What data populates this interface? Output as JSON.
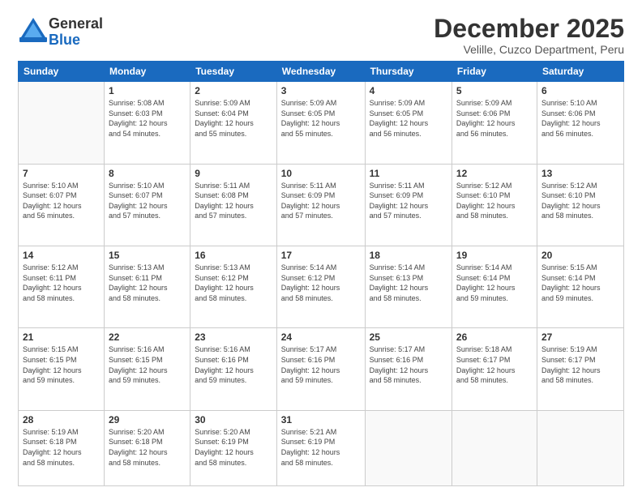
{
  "logo": {
    "general": "General",
    "blue": "Blue"
  },
  "title": "December 2025",
  "subtitle": "Velille, Cuzco Department, Peru",
  "days_header": [
    "Sunday",
    "Monday",
    "Tuesday",
    "Wednesday",
    "Thursday",
    "Friday",
    "Saturday"
  ],
  "weeks": [
    [
      {
        "num": "",
        "info": ""
      },
      {
        "num": "1",
        "info": "Sunrise: 5:08 AM\nSunset: 6:03 PM\nDaylight: 12 hours\nand 54 minutes."
      },
      {
        "num": "2",
        "info": "Sunrise: 5:09 AM\nSunset: 6:04 PM\nDaylight: 12 hours\nand 55 minutes."
      },
      {
        "num": "3",
        "info": "Sunrise: 5:09 AM\nSunset: 6:05 PM\nDaylight: 12 hours\nand 55 minutes."
      },
      {
        "num": "4",
        "info": "Sunrise: 5:09 AM\nSunset: 6:05 PM\nDaylight: 12 hours\nand 56 minutes."
      },
      {
        "num": "5",
        "info": "Sunrise: 5:09 AM\nSunset: 6:06 PM\nDaylight: 12 hours\nand 56 minutes."
      },
      {
        "num": "6",
        "info": "Sunrise: 5:10 AM\nSunset: 6:06 PM\nDaylight: 12 hours\nand 56 minutes."
      }
    ],
    [
      {
        "num": "7",
        "info": "Sunrise: 5:10 AM\nSunset: 6:07 PM\nDaylight: 12 hours\nand 56 minutes."
      },
      {
        "num": "8",
        "info": "Sunrise: 5:10 AM\nSunset: 6:07 PM\nDaylight: 12 hours\nand 57 minutes."
      },
      {
        "num": "9",
        "info": "Sunrise: 5:11 AM\nSunset: 6:08 PM\nDaylight: 12 hours\nand 57 minutes."
      },
      {
        "num": "10",
        "info": "Sunrise: 5:11 AM\nSunset: 6:09 PM\nDaylight: 12 hours\nand 57 minutes."
      },
      {
        "num": "11",
        "info": "Sunrise: 5:11 AM\nSunset: 6:09 PM\nDaylight: 12 hours\nand 57 minutes."
      },
      {
        "num": "12",
        "info": "Sunrise: 5:12 AM\nSunset: 6:10 PM\nDaylight: 12 hours\nand 58 minutes."
      },
      {
        "num": "13",
        "info": "Sunrise: 5:12 AM\nSunset: 6:10 PM\nDaylight: 12 hours\nand 58 minutes."
      }
    ],
    [
      {
        "num": "14",
        "info": "Sunrise: 5:12 AM\nSunset: 6:11 PM\nDaylight: 12 hours\nand 58 minutes."
      },
      {
        "num": "15",
        "info": "Sunrise: 5:13 AM\nSunset: 6:11 PM\nDaylight: 12 hours\nand 58 minutes."
      },
      {
        "num": "16",
        "info": "Sunrise: 5:13 AM\nSunset: 6:12 PM\nDaylight: 12 hours\nand 58 minutes."
      },
      {
        "num": "17",
        "info": "Sunrise: 5:14 AM\nSunset: 6:12 PM\nDaylight: 12 hours\nand 58 minutes."
      },
      {
        "num": "18",
        "info": "Sunrise: 5:14 AM\nSunset: 6:13 PM\nDaylight: 12 hours\nand 58 minutes."
      },
      {
        "num": "19",
        "info": "Sunrise: 5:14 AM\nSunset: 6:14 PM\nDaylight: 12 hours\nand 59 minutes."
      },
      {
        "num": "20",
        "info": "Sunrise: 5:15 AM\nSunset: 6:14 PM\nDaylight: 12 hours\nand 59 minutes."
      }
    ],
    [
      {
        "num": "21",
        "info": "Sunrise: 5:15 AM\nSunset: 6:15 PM\nDaylight: 12 hours\nand 59 minutes."
      },
      {
        "num": "22",
        "info": "Sunrise: 5:16 AM\nSunset: 6:15 PM\nDaylight: 12 hours\nand 59 minutes."
      },
      {
        "num": "23",
        "info": "Sunrise: 5:16 AM\nSunset: 6:16 PM\nDaylight: 12 hours\nand 59 minutes."
      },
      {
        "num": "24",
        "info": "Sunrise: 5:17 AM\nSunset: 6:16 PM\nDaylight: 12 hours\nand 59 minutes."
      },
      {
        "num": "25",
        "info": "Sunrise: 5:17 AM\nSunset: 6:16 PM\nDaylight: 12 hours\nand 58 minutes."
      },
      {
        "num": "26",
        "info": "Sunrise: 5:18 AM\nSunset: 6:17 PM\nDaylight: 12 hours\nand 58 minutes."
      },
      {
        "num": "27",
        "info": "Sunrise: 5:19 AM\nSunset: 6:17 PM\nDaylight: 12 hours\nand 58 minutes."
      }
    ],
    [
      {
        "num": "28",
        "info": "Sunrise: 5:19 AM\nSunset: 6:18 PM\nDaylight: 12 hours\nand 58 minutes."
      },
      {
        "num": "29",
        "info": "Sunrise: 5:20 AM\nSunset: 6:18 PM\nDaylight: 12 hours\nand 58 minutes."
      },
      {
        "num": "30",
        "info": "Sunrise: 5:20 AM\nSunset: 6:19 PM\nDaylight: 12 hours\nand 58 minutes."
      },
      {
        "num": "31",
        "info": "Sunrise: 5:21 AM\nSunset: 6:19 PM\nDaylight: 12 hours\nand 58 minutes."
      },
      {
        "num": "",
        "info": ""
      },
      {
        "num": "",
        "info": ""
      },
      {
        "num": "",
        "info": ""
      }
    ]
  ]
}
